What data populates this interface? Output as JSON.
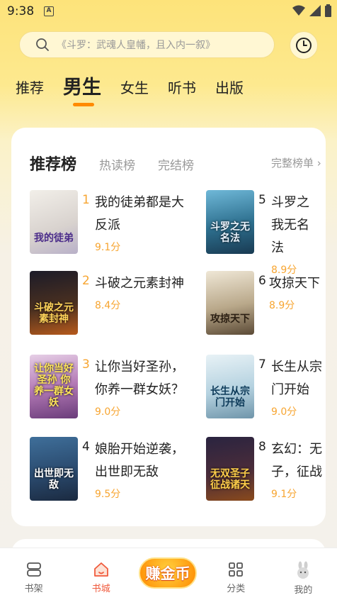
{
  "status_bar": {
    "time": "9:38",
    "notification_icon": "A"
  },
  "search": {
    "placeholder": "《斗罗：武魂人皇幡，且入内一叙》"
  },
  "channel_tabs": [
    "推荐",
    "男生",
    "女生",
    "听书",
    "出版"
  ],
  "active_channel": "男生",
  "rank_tabs": [
    "推荐榜",
    "热读榜",
    "完结榜"
  ],
  "rank_more": "完整榜单 ›",
  "books": [
    {
      "rank": "1",
      "title": "我的徒弟都是大反派",
      "score": "9.1分",
      "cover_text": "我的徒弟"
    },
    {
      "rank": "2",
      "title": "斗破之元素封神",
      "score": "8.4分",
      "cover_text": "斗破之元素封神"
    },
    {
      "rank": "3",
      "title": "让你当好圣孙，你养一群女妖？",
      "score": "9.0分",
      "cover_text": "让你当好圣孙 你养一群女妖"
    },
    {
      "rank": "4",
      "title": "娘胎开始逆袭，出世即无敌",
      "score": "9.5分",
      "cover_text": "出世即无敌"
    },
    {
      "rank": "5",
      "title": "斗罗之我无名法",
      "score": "8.9分",
      "cover_text": "斗罗之无名法"
    },
    {
      "rank": "6",
      "title": "攻掠天下",
      "score": "8.9分",
      "cover_text": "攻掠天下"
    },
    {
      "rank": "7",
      "title": "长生从宗门开始",
      "score": "9.0分",
      "cover_text": "长生从宗门开始"
    },
    {
      "rank": "8",
      "title": "玄幻：无子，征战",
      "score": "9.1分",
      "cover_text": "无双圣子征战诸天"
    }
  ],
  "bottom_nav": [
    "书架",
    "书城",
    "赚金币",
    "分类",
    "我的"
  ],
  "active_nav": "书城",
  "colors": {
    "accent": "#ff8a00",
    "score": "#f7a531",
    "nav_active": "#f05a3c"
  }
}
